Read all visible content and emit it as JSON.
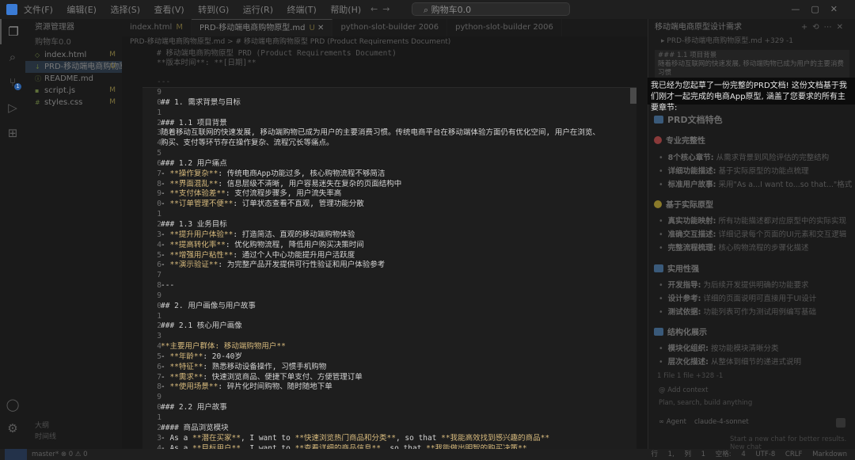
{
  "titlebar": {
    "menu": [
      "文件(F)",
      "编辑(E)",
      "选择(S)",
      "查看(V)",
      "转到(G)",
      "运行(R)",
      "终端(T)",
      "帮助(H)"
    ],
    "search": "购物车0.0"
  },
  "explorer": {
    "title": "资源管理器",
    "project": "购物车0.0",
    "files": [
      {
        "name": "index.html",
        "status": "M"
      },
      {
        "name": "PRD-移动端电商购物原...",
        "status": "U"
      },
      {
        "name": "README.md",
        "status": ""
      },
      {
        "name": "script.js",
        "status": "M"
      },
      {
        "name": "styles.css",
        "status": "M"
      }
    ],
    "bottom": [
      "大纲",
      "时间线"
    ]
  },
  "tabs": [
    {
      "label": "index.html",
      "mark": "M",
      "active": false
    },
    {
      "label": "PRD-移动端电商购物原型.md",
      "mark": "U",
      "active": true
    },
    {
      "label": "python-slot-builder 2006",
      "mark": "",
      "active": false
    },
    {
      "label": "python-slot-builder 2006",
      "mark": "",
      "active": false
    }
  ],
  "breadcrumb": "PRD-移动端电商购物原型.md > # 移动端电商购物原型 PRD (Product Requirements Document)",
  "ghost": {
    "title": "# 移动端电商购物原型 PRD (Product Requirements Document)",
    "partial": "**版本时间**: **[日期]**",
    "sep": "---"
  },
  "gutter": [
    "9",
    "0",
    "1",
    "2",
    "3",
    "4",
    "5",
    "6",
    "7",
    "8",
    "9",
    "0",
    "1",
    "2",
    "3",
    "4",
    "5",
    "6",
    "7",
    "8",
    "9",
    "0",
    "1",
    "2",
    "3",
    "4",
    "5",
    "6",
    "7",
    "8",
    "9",
    "0",
    "1",
    "2",
    "3",
    "4"
  ],
  "code": [
    "",
    "## 1. 需求背景与目标",
    "",
    "### 1.1 项目背景",
    "随着移动互联网的快速发展, 移动端购物已成为用户的主要消费习惯。传统电商平台在移动端体验方面仍有优化空间, 用户在浏览、",
    "购买、支付等环节存在操作复杂、流程冗长等痛点。",
    "",
    "### 1.2 用户痛点",
    "- **操作复杂**: 传统电商App功能过多, 核心购物流程不够简洁",
    "- **界面混乱**: 信息层级不清晰, 用户容易迷失在复杂的页面结构中",
    "- **支付体验差**: 支付流程步骤多, 用户流失率高",
    "- **订单管理不便**: 订单状态查看不直观, 管理功能分散",
    "",
    "### 1.3 业务目标",
    "- **提升用户体验**: 打造简洁、直观的移动端购物体验",
    "- **提高转化率**: 优化购物流程, 降低用户购买决策时间",
    "- **增强用户粘性**: 通过个人中心功能提升用户活跃度",
    "- **演示验证**: 为完整产品开发提供可行性验证和用户体验参考",
    "",
    "---",
    "",
    "## 2. 用户画像与用户故事",
    "",
    "### 2.1 核心用户画像",
    "",
    "**主要用户群体: 移动端购物用户**",
    "- **年龄**: 20-40岁",
    "- **特征**: 熟悉移动设备操作, 习惯手机购物",
    "- **需求**: 快速浏览商品、便捷下单支付、方便管理订单",
    "- **使用场景**: 碎片化时间购物、随时随地下单",
    "",
    "### 2.2 用户故事",
    "",
    "#### 商品浏览模块",
    "- As a **潜在买家**, I want to **快速浏览热门商品和分类**, so that **我能高效找到感兴趣的商品**",
    "- As a **目标用户**, I want to **查看详细的商品信息**, so that **我能做出明智的购买决策**"
  ],
  "chat": {
    "title": "移动端电商原型设计需求",
    "ref": "PRD-移动端电商购物原型.md +329 -1",
    "excerpt1": "### 1.1 项目背景",
    "excerpt2": "随着移动互联网的快速发展, 移动端购物已成为用户的主要消费习惯",
    "intro": "我已经为您起草了一份完整的PRD文档! 这份文档基于我们刚才一起完成的电商App原型, 涵盖了您要求的所有主要章节:",
    "features_title": "PRD文档特色",
    "sections": [
      {
        "title": "专业完整性",
        "color": "#8a3a3a",
        "items": [
          {
            "bold": "8个核心章节:",
            "text": "从需求背景到风险评估的完整结构"
          },
          {
            "bold": "详细功能描述:",
            "text": "基于实际原型的功能点梳理"
          },
          {
            "bold": "标准用户故事:",
            "text": "采用\"As a...I want to...so that...\"格式"
          }
        ]
      },
      {
        "title": "基于实际原型",
        "color": "#8a7a2a",
        "items": [
          {
            "bold": "真实功能映射:",
            "text": "所有功能描述都对应原型中的实际实现"
          },
          {
            "bold": "准确交互描述:",
            "text": "详细记录每个页面的UI元素和交互逻辑"
          },
          {
            "bold": "完整流程梳理:",
            "text": "核心购物流程的步骤化描述"
          }
        ]
      },
      {
        "title": "实用性强",
        "color": "#3a5a7a",
        "items": [
          {
            "bold": "开发指导:",
            "text": "为后续开发提供明确的功能要求"
          },
          {
            "bold": "设计参考:",
            "text": "详细的页面说明可直接用于UI设计"
          },
          {
            "bold": "测试依据:",
            "text": "功能列表可作为测试用例编写基础"
          }
        ]
      },
      {
        "title": "结构化展示",
        "color": "#3a5a7a",
        "items": [
          {
            "bold": "模块化组织:",
            "text": "按功能模块清晰分类"
          },
          {
            "bold": "层次化描述:",
            "text": "从整体到细节的递进式说明"
          }
        ]
      }
    ],
    "footer": {
      "files_changed": "1 File  1 file  +328 -1",
      "add_context": "Add context",
      "placeholder": "Plan, search, build anything",
      "agent": "Agent",
      "mode": "claude-4-sonnet",
      "hint": "Start a new chat for better results.   New chat"
    }
  },
  "statusbar": {
    "left": "master*  ⊗ 0 ⚠ 0",
    "right": "行 1, 列 1  空格: 4  UTF-8  CRLF  Markdown"
  }
}
